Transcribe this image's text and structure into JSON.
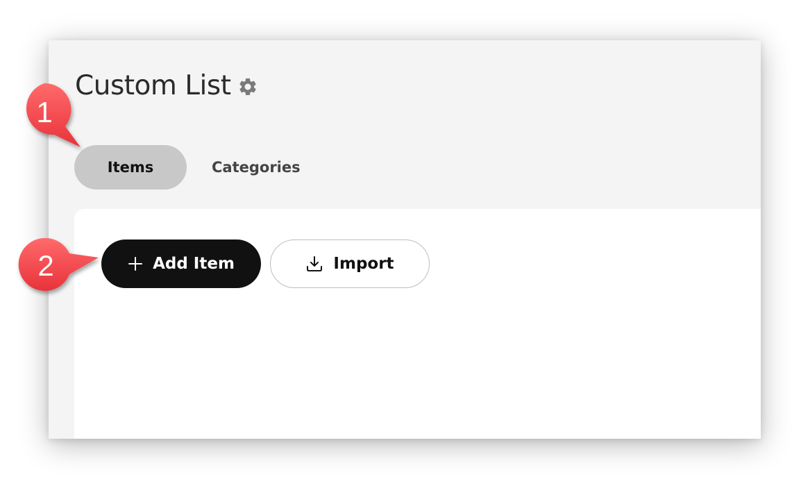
{
  "page": {
    "title": "Custom List"
  },
  "icons": {
    "settings": "gear-icon",
    "add": "plus-icon",
    "import": "download-icon"
  },
  "tabs": [
    {
      "label": "Items",
      "active": true
    },
    {
      "label": "Categories",
      "active": false
    }
  ],
  "toolbar": {
    "add_label": "Add Item",
    "import_label": "Import"
  },
  "callouts": [
    {
      "number": "1",
      "target": "Items tab"
    },
    {
      "number": "2",
      "target": "Add Item button"
    }
  ],
  "colors": {
    "callout": "#f4424a",
    "primary_button": "#111111",
    "active_tab": "#c8c8c8",
    "window_bg": "#f4f4f4"
  }
}
